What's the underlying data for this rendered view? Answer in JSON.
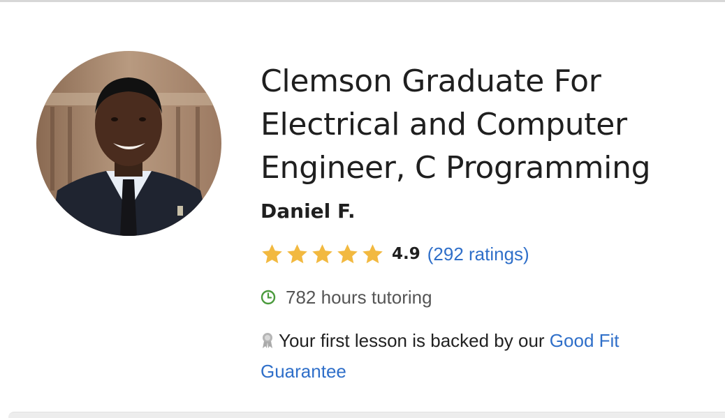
{
  "profile": {
    "title": "Clemson Graduate For Electrical and Computer Engineer, C Programming",
    "name": "Daniel F.",
    "rating": {
      "stars": 5,
      "value": "4.9",
      "count_label": "(292 ratings)"
    },
    "hours": "782 hours tutoring",
    "guarantee": {
      "text": "Your first lesson is backed by our ",
      "link": "Good Fit Guarantee"
    }
  },
  "icons": {
    "star": "star-icon",
    "clock": "clock-icon",
    "ribbon": "ribbon-icon"
  },
  "colors": {
    "star": "#f2b940",
    "link": "#2f6fc9",
    "clock": "#4a9a3c",
    "ribbon": "#aaaaaa"
  }
}
